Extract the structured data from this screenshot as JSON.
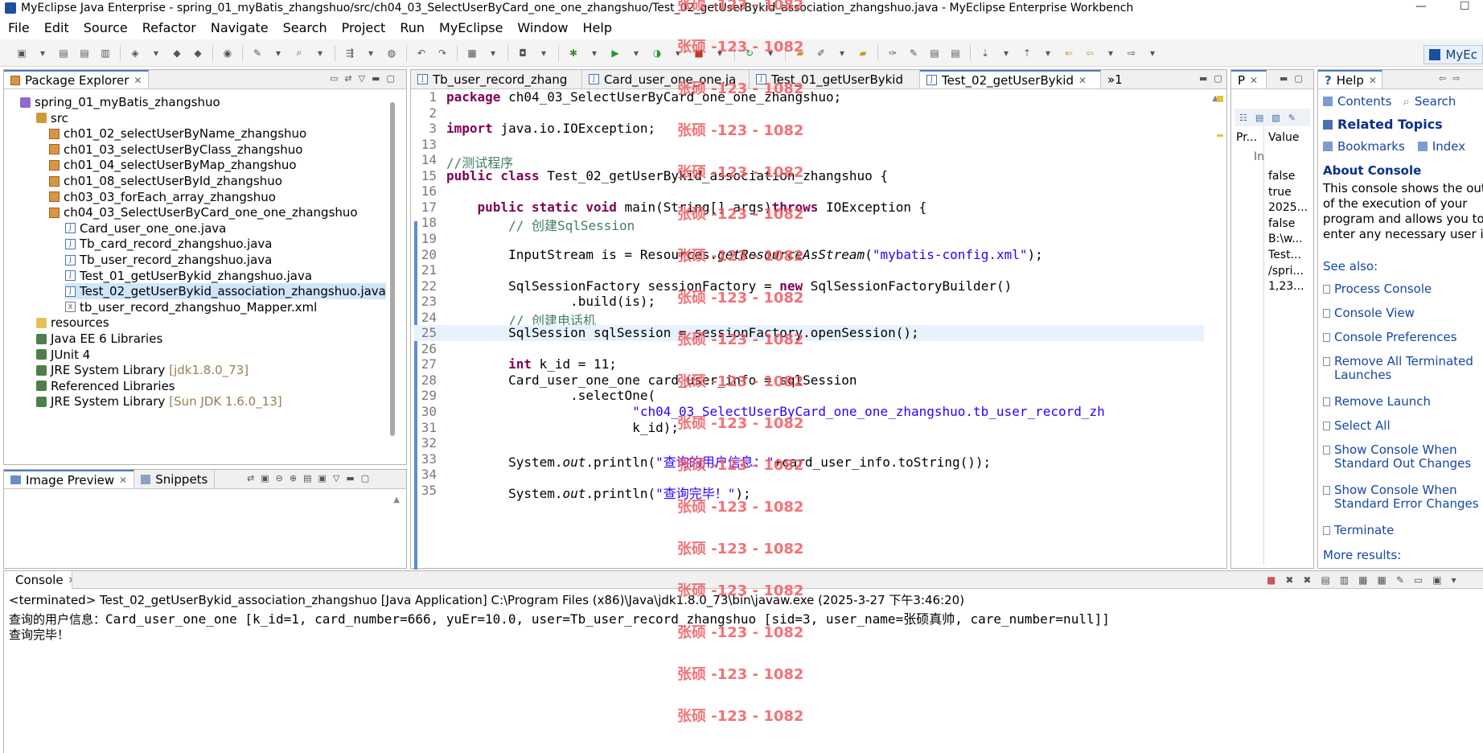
{
  "window": {
    "title": "MyEclipse Java Enterprise - spring_01_myBatis_zhangshuo/src/ch04_03_SelectUserByCard_one_one_zhangshuo/Test_02_getUserBykid_association_zhangshuo.java - MyEclipse Enterprise Workbench",
    "minimize": "—",
    "maximize": "☐"
  },
  "menu": [
    "File",
    "Edit",
    "Source",
    "Refactor",
    "Navigate",
    "Search",
    "Project",
    "Run",
    "MyEclipse",
    "Window",
    "Help"
  ],
  "perspective": {
    "label": "MyEc"
  },
  "package_explorer": {
    "tab": "Package Explorer",
    "rows": [
      {
        "text": "spring_01_myBatis_zhangshuo",
        "icon": "project-icon"
      },
      {
        "text": "src",
        "icon": "source-folder-icon"
      },
      {
        "text": "ch01_02_selectUserByName_zhangshuo",
        "icon": "package-icon"
      },
      {
        "text": "ch01_03_selectUserByClass_zhangshuo",
        "icon": "package-icon"
      },
      {
        "text": "ch01_04_selectUserByMap_zhangshuo",
        "icon": "package-icon"
      },
      {
        "text": "ch01_08_selectUserById_zhangshuo",
        "icon": "package-icon"
      },
      {
        "text": "ch03_03_forEach_array_zhangshuo",
        "icon": "package-icon"
      },
      {
        "text": "ch04_03_SelectUserByCard_one_one_zhangshuo",
        "icon": "package-icon"
      },
      {
        "text": "Card_user_one_one.java",
        "icon": "java-file-icon"
      },
      {
        "text": "Tb_card_record_zhangshuo.java",
        "icon": "java-file-icon"
      },
      {
        "text": "Tb_user_record_zhangshuo.java",
        "icon": "java-file-icon"
      },
      {
        "text": "Test_01_getUserBykid_zhangshuo.java",
        "icon": "java-file-icon"
      },
      {
        "text": "Test_02_getUserBykid_association_zhangshuo.java",
        "icon": "java-file-icon"
      },
      {
        "text": "tb_user_record_zhangshuo_Mapper.xml",
        "icon": "xml-file-icon"
      },
      {
        "text": "resources",
        "icon": "folder-icon"
      },
      {
        "text": "Java EE 6 Libraries",
        "icon": "library-icon"
      },
      {
        "text": "JUnit 4",
        "icon": "library-icon"
      },
      {
        "text": "JRE System Library",
        "suffix": "[jdk1.8.0_73]",
        "icon": "library-icon"
      },
      {
        "text": "Referenced Libraries",
        "icon": "library-icon"
      },
      {
        "text": "JRE System Library",
        "suffix": "[Sun JDK 1.6.0_13]",
        "icon": "library-icon"
      }
    ]
  },
  "image_preview": {
    "tab": "Image Preview",
    "tab2": "Snippets"
  },
  "editor": {
    "tabs": [
      "Tb_user_record_zhang",
      "Card_user_one_one.ja",
      "Test_01_getUserBykid",
      "Test_02_getUserBykid"
    ],
    "overflow": "»1",
    "lines": [
      {
        "n": "1",
        "parts": [
          [
            "kw",
            "package"
          ],
          [
            "",
            "ch04_03_SelectUserByCard_one_one_zhangshuo;"
          ]
        ]
      },
      {
        "n": "2",
        "parts": []
      },
      {
        "n": "3",
        "parts": [
          [
            "kw",
            "import"
          ],
          [
            "",
            "java.io.IOException;"
          ]
        ]
      },
      {
        "n": "13",
        "parts": []
      },
      {
        "n": "14",
        "parts": [
          [
            "cmt",
            "//测试程序"
          ]
        ]
      },
      {
        "n": "15",
        "parts": [
          [
            "kw",
            "public class"
          ],
          [
            "",
            "Test_02_getUserBykid_association_zhangshuo {"
          ]
        ]
      },
      {
        "n": "16",
        "parts": []
      },
      {
        "n": "17",
        "parts": [
          [
            "",
            "    "
          ],
          [
            "kw",
            "public static void"
          ],
          [
            "",
            "main(String[] args)"
          ],
          [
            "kw",
            "throws"
          ],
          [
            "",
            "IOException {"
          ]
        ]
      },
      {
        "n": "18",
        "parts": [
          [
            "",
            "        "
          ],
          [
            "cmt",
            "// 创建SqlSession"
          ]
        ]
      },
      {
        "n": "19",
        "parts": []
      },
      {
        "n": "20",
        "parts": [
          [
            "",
            "        InputStream is = Resources."
          ],
          [
            "it",
            "getResourceAsStream"
          ],
          [
            "",
            "("
          ],
          [
            "str",
            "\"mybatis-config.xml\""
          ],
          [
            "",
            ");"
          ]
        ]
      },
      {
        "n": "21",
        "parts": []
      },
      {
        "n": "22",
        "parts": [
          [
            "",
            "        SqlSessionFactory sessionFactory = "
          ],
          [
            "kw",
            "new"
          ],
          [
            "",
            "SqlSessionFactoryBuilder()"
          ]
        ]
      },
      {
        "n": "23",
        "parts": [
          [
            "",
            "                .build(is);"
          ]
        ]
      },
      {
        "n": "24",
        "parts": [
          [
            "",
            "        "
          ],
          [
            "cmt",
            "// 创建电话机"
          ]
        ]
      },
      {
        "n": "25",
        "parts": [
          [
            "",
            "        SqlSession sqlSession = sessionFactory.openSession();"
          ]
        ]
      },
      {
        "n": "26",
        "parts": []
      },
      {
        "n": "27",
        "parts": [
          [
            "",
            "        "
          ],
          [
            "kw",
            "int"
          ],
          [
            "",
            "k_id = 11;"
          ]
        ]
      },
      {
        "n": "28",
        "parts": [
          [
            "",
            "        Card_user_one_one card_user_info = sqlSession"
          ]
        ]
      },
      {
        "n": "29",
        "parts": [
          [
            "",
            "                .selectOne("
          ]
        ]
      },
      {
        "n": "30",
        "parts": [
          [
            "",
            "                        "
          ],
          [
            "str",
            "\"ch04_03_SelectUserByCard_one_one_zhangshuo.tb_user_record_zh"
          ]
        ]
      },
      {
        "n": "31",
        "parts": [
          [
            "",
            "                        k_id);"
          ]
        ]
      },
      {
        "n": "32",
        "parts": []
      },
      {
        "n": "33",
        "parts": [
          [
            "",
            "        System."
          ],
          [
            "it",
            "out"
          ],
          [
            "",
            ".println("
          ],
          [
            "str",
            "\"查询的用户信息：\""
          ],
          [
            "",
            "+card_user_info.toString());"
          ]
        ]
      },
      {
        "n": "34",
        "parts": []
      },
      {
        "n": "35",
        "parts": [
          [
            "",
            "        System."
          ],
          [
            "it",
            "out"
          ],
          [
            "",
            ".println("
          ],
          [
            "str",
            "\"查询完毕！\""
          ],
          [
            "",
            ");"
          ]
        ]
      }
    ]
  },
  "properties": {
    "tab": "P",
    "col1": "Pr...",
    "col2": "Value",
    "sub": "In",
    "values": [
      "false",
      "true",
      "2025...",
      "false",
      "B:\\w...",
      "Test...",
      "/spri...",
      "1,23..."
    ]
  },
  "help": {
    "tab": "Help",
    "contents": "Contents",
    "search": "Search",
    "related": "Related Topics",
    "bookmarks": "Bookmarks",
    "index": "Index",
    "about_title": "About Console",
    "about_lines": [
      "This console shows the out",
      "of the execution of your",
      "program and allows you to",
      "enter any necessary user in"
    ],
    "see_also": "See also:",
    "links": [
      "Process Console",
      "Console View",
      "Console Preferences",
      "Remove All Terminated\nLaunches",
      "Remove Launch",
      "Select All",
      "Show Console When\nStandard Out Changes",
      "Show Console When\nStandard Error Changes",
      "Terminate"
    ],
    "more": "More results:"
  },
  "console": {
    "tab": "Console",
    "status": "<terminated> Test_02_getUserBykid_association_zhangshuo [Java Application] C:\\Program Files (x86)\\Java\\jdk1.8.0_73\\bin\\javaw.exe (2025-3-27 下午3:46:20)",
    "output_label": "查询的用户信息：",
    "output_value": "Card_user_one_one [k_id=1, card_number=666, yuEr=10.0, user=Tb_user_record_zhangshuo [sid=3, user_name=张硕真帅, care_number=null]]",
    "output2": "查询完毕！"
  },
  "watermark": "张硕 -123 - 1082"
}
